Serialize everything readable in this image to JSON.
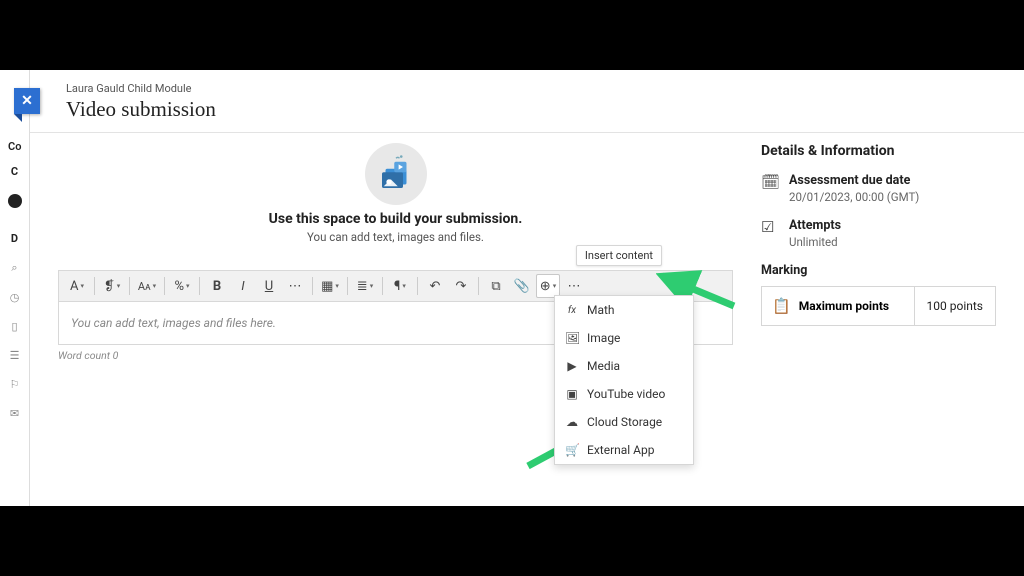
{
  "breadcrumb": "Laura Gauld Child Module",
  "page_title": "Video submission",
  "sideapp": {
    "tab": "Co",
    "initial": "C",
    "section": "D"
  },
  "hero": {
    "heading": "Use this space to build your submission.",
    "sub": "You can add text, images and files."
  },
  "editor": {
    "placeholder": "You can add text, images and files here.",
    "word_count_label": "Word count",
    "word_count_value": "0",
    "tooltip": "Insert content"
  },
  "insert_menu": [
    {
      "icon": "fx",
      "label": "Math"
    },
    {
      "icon": "🖼",
      "label": "Image"
    },
    {
      "icon": "▶",
      "label": "Media"
    },
    {
      "icon": "▣",
      "label": "YouTube video"
    },
    {
      "icon": "☁",
      "label": "Cloud Storage"
    },
    {
      "icon": "🛒",
      "label": "External App"
    }
  ],
  "sidebar": {
    "title": "Details & Information",
    "due_label": "Assessment due date",
    "due_value": "20/01/2023, 00:00 (GMT)",
    "attempts_label": "Attempts",
    "attempts_value": "Unlimited",
    "marking_label": "Marking",
    "max_points_label": "Maximum points",
    "max_points_value": "100 points"
  }
}
